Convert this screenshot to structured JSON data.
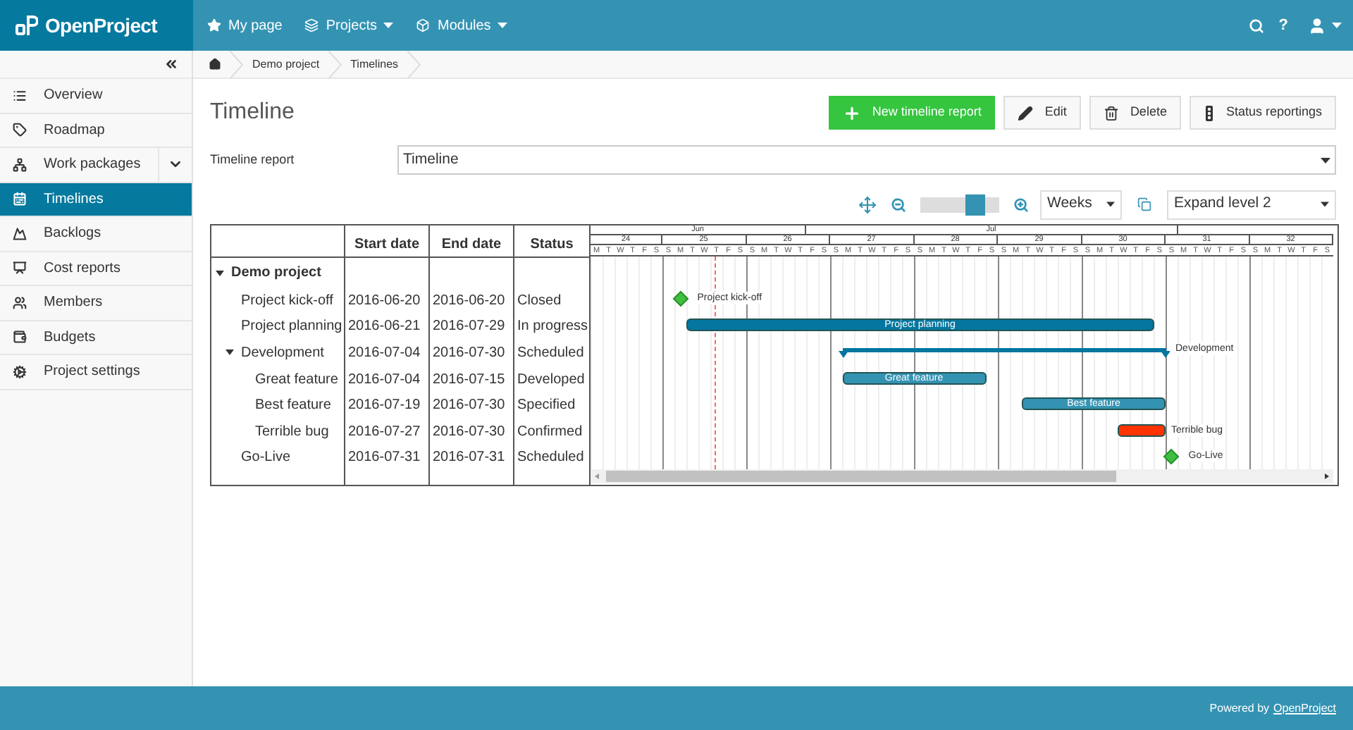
{
  "header": {
    "logo": "OpenProject",
    "nav": [
      {
        "label": "My page",
        "dropdown": false
      },
      {
        "label": "Projects",
        "dropdown": true
      },
      {
        "label": "Modules",
        "dropdown": true
      }
    ],
    "help": "?"
  },
  "sidebar": {
    "items": [
      {
        "label": "Overview",
        "selected": false,
        "expandable": false
      },
      {
        "label": "Roadmap",
        "selected": false,
        "expandable": false
      },
      {
        "label": "Work packages",
        "selected": false,
        "expandable": true
      },
      {
        "label": "Timelines",
        "selected": true,
        "expandable": false
      },
      {
        "label": "Backlogs",
        "selected": false,
        "expandable": false
      },
      {
        "label": "Cost reports",
        "selected": false,
        "expandable": false
      },
      {
        "label": "Members",
        "selected": false,
        "expandable": false
      },
      {
        "label": "Budgets",
        "selected": false,
        "expandable": false
      },
      {
        "label": "Project settings",
        "selected": false,
        "expandable": false
      }
    ]
  },
  "breadcrumb": [
    "Demo project",
    "Timelines"
  ],
  "page": {
    "title": "Timeline",
    "actions": [
      {
        "label": "New timeline report",
        "kind": "primary"
      },
      {
        "label": "Edit",
        "kind": "edit"
      },
      {
        "label": "Delete",
        "kind": "delete"
      },
      {
        "label": "Status reportings",
        "kind": "status"
      }
    ],
    "report_label": "Timeline report",
    "report_value": "Timeline"
  },
  "toolbar": {
    "zoom": {
      "level": 0.7
    },
    "scale": "Weeks",
    "expand": "Expand level 2"
  },
  "timeline": {
    "columns": [
      "Start date",
      "End date",
      "Status"
    ],
    "months": [
      "Jun",
      "Jul"
    ],
    "weeks": [
      "24",
      "25",
      "26",
      "27",
      "28",
      "29",
      "30",
      "31",
      "32"
    ],
    "days": [
      "M",
      "T",
      "W",
      "T",
      "F",
      "S",
      "S",
      "M",
      "T",
      "W",
      "T",
      "F",
      "S",
      "S",
      "M",
      "T",
      "W",
      "T",
      "F",
      "S",
      "S",
      "M",
      "T",
      "W",
      "T",
      "F",
      "S",
      "S",
      "M",
      "T",
      "W",
      "T",
      "F",
      "S",
      "S",
      "M",
      "T",
      "W",
      "T",
      "F",
      "S",
      "S",
      "M",
      "T",
      "W",
      "T",
      "F",
      "S",
      "S",
      "M",
      "T",
      "W",
      "T",
      "F",
      "S",
      "S",
      "M",
      "T",
      "W",
      "T",
      "F",
      "S"
    ],
    "rows": [
      {
        "name": "Demo project",
        "expanded": true,
        "children": [
          {
            "name": "Project kick-off",
            "start": "2016-06-20",
            "end": "2016-06-20",
            "status": "Closed",
            "bar": {
              "kind": "milestone",
              "color": "#3fbf3f",
              "label": "Project kick-off"
            }
          },
          {
            "name": "Project planning",
            "start": "2016-06-21",
            "end": "2016-07-29",
            "status": "In progress",
            "bar": {
              "kind": "bar",
              "color": "#04769f",
              "label": "Project planning"
            }
          },
          {
            "name": "Development",
            "start": "2016-07-04",
            "end": "2016-07-30",
            "status": "Scheduled",
            "expanded": true,
            "bar": {
              "kind": "group",
              "color": "#04769f",
              "label": "Development"
            },
            "children": [
              {
                "name": "Great feature",
                "start": "2016-07-04",
                "end": "2016-07-15",
                "status": "Developed",
                "bar": {
                  "kind": "bar",
                  "color": "#3493b3",
                  "label": "Great feature"
                }
              },
              {
                "name": "Best feature",
                "start": "2016-07-19",
                "end": "2016-07-30",
                "status": "Specified",
                "bar": {
                  "kind": "bar",
                  "color": "#3493b3",
                  "label": "Best feature"
                }
              },
              {
                "name": "Terrible bug",
                "start": "2016-07-27",
                "end": "2016-07-30",
                "status": "Confirmed",
                "bar": {
                  "kind": "short-bar",
                  "color": "#ff3300",
                  "label": "Terrible bug"
                }
              }
            ]
          },
          {
            "name": "Go-Live",
            "start": "2016-07-31",
            "end": "2016-07-31",
            "status": "Scheduled",
            "bar": {
              "kind": "milestone",
              "color": "#3fbf3f",
              "label": "Go-Live"
            }
          }
        ]
      }
    ]
  },
  "footer": {
    "text": "Powered by",
    "link": "OpenProject"
  }
}
